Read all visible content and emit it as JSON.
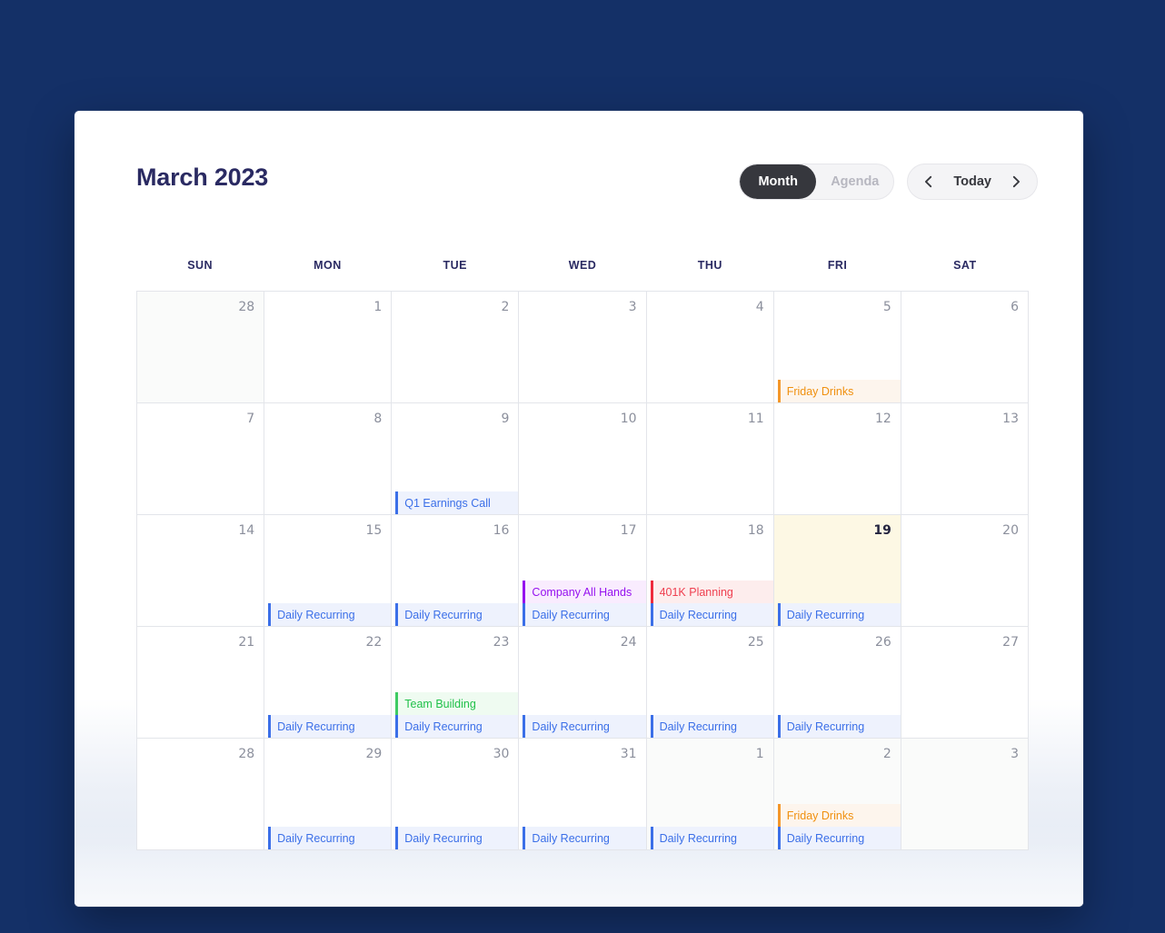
{
  "header": {
    "title": "March 2023",
    "views": [
      {
        "label": "Month",
        "active": true
      },
      {
        "label": "Agenda",
        "active": false
      }
    ],
    "nav": {
      "prev_icon": "chevron-left-icon",
      "today_label": "Today",
      "next_icon": "chevron-right-icon"
    }
  },
  "weekdays": [
    "SUN",
    "MON",
    "TUE",
    "WED",
    "THU",
    "FRI",
    "SAT"
  ],
  "colors": {
    "page_background": "#143067",
    "card_background": "#ffffff",
    "title": "#2a2a62",
    "grid_line": "#e3e5ea",
    "day_number": "#8b8f9c",
    "today_background": "#fdf8e4",
    "other_month_background": "#fafbfa",
    "segment_active_background": "#36373d",
    "event_blue": "#3b6fe8",
    "event_orange": "#f0900f",
    "event_purple": "#9611ef",
    "event_red": "#ef4050",
    "event_green": "#21c14a"
  },
  "weeks": [
    {
      "days": [
        {
          "number": "28",
          "other_month": true,
          "today": false,
          "events": []
        },
        {
          "number": "1",
          "other_month": false,
          "today": false,
          "events": []
        },
        {
          "number": "2",
          "other_month": false,
          "today": false,
          "events": []
        },
        {
          "number": "3",
          "other_month": false,
          "today": false,
          "events": []
        },
        {
          "number": "4",
          "other_month": false,
          "today": false,
          "events": []
        },
        {
          "number": "5",
          "other_month": false,
          "today": false,
          "events": [
            {
              "title": "Friday Drinks",
              "color": "orange"
            }
          ]
        },
        {
          "number": "6",
          "other_month": false,
          "today": false,
          "events": []
        }
      ]
    },
    {
      "days": [
        {
          "number": "7",
          "other_month": false,
          "today": false,
          "events": []
        },
        {
          "number": "8",
          "other_month": false,
          "today": false,
          "events": []
        },
        {
          "number": "9",
          "other_month": false,
          "today": false,
          "events": [
            {
              "title": "Q1 Earnings Call",
              "color": "blue"
            }
          ]
        },
        {
          "number": "10",
          "other_month": false,
          "today": false,
          "events": []
        },
        {
          "number": "11",
          "other_month": false,
          "today": false,
          "events": []
        },
        {
          "number": "12",
          "other_month": false,
          "today": false,
          "events": []
        },
        {
          "number": "13",
          "other_month": false,
          "today": false,
          "events": []
        }
      ]
    },
    {
      "days": [
        {
          "number": "14",
          "other_month": false,
          "today": false,
          "events": []
        },
        {
          "number": "15",
          "other_month": false,
          "today": false,
          "events": [
            {
              "title": "Daily Recurring",
              "color": "blue"
            }
          ]
        },
        {
          "number": "16",
          "other_month": false,
          "today": false,
          "events": [
            {
              "title": "Daily Recurring",
              "color": "blue"
            }
          ]
        },
        {
          "number": "17",
          "other_month": false,
          "today": false,
          "events": [
            {
              "title": "Company All Hands",
              "color": "purple"
            },
            {
              "title": "Daily Recurring",
              "color": "blue"
            }
          ]
        },
        {
          "number": "18",
          "other_month": false,
          "today": false,
          "events": [
            {
              "title": "401K Planning",
              "color": "red"
            },
            {
              "title": "Daily Recurring",
              "color": "blue"
            }
          ]
        },
        {
          "number": "19",
          "other_month": false,
          "today": true,
          "events": [
            {
              "title": "Daily Recurring",
              "color": "blue"
            }
          ]
        },
        {
          "number": "20",
          "other_month": false,
          "today": false,
          "events": []
        }
      ]
    },
    {
      "days": [
        {
          "number": "21",
          "other_month": false,
          "today": false,
          "events": []
        },
        {
          "number": "22",
          "other_month": false,
          "today": false,
          "events": [
            {
              "title": "Daily Recurring",
              "color": "blue"
            }
          ]
        },
        {
          "number": "23",
          "other_month": false,
          "today": false,
          "events": [
            {
              "title": "Team Building",
              "color": "green"
            },
            {
              "title": "Daily Recurring",
              "color": "blue"
            }
          ]
        },
        {
          "number": "24",
          "other_month": false,
          "today": false,
          "events": [
            {
              "title": "Daily Recurring",
              "color": "blue"
            }
          ]
        },
        {
          "number": "25",
          "other_month": false,
          "today": false,
          "events": [
            {
              "title": "Daily Recurring",
              "color": "blue"
            }
          ]
        },
        {
          "number": "26",
          "other_month": false,
          "today": false,
          "events": [
            {
              "title": "Daily Recurring",
              "color": "blue"
            }
          ]
        },
        {
          "number": "27",
          "other_month": false,
          "today": false,
          "events": []
        }
      ]
    },
    {
      "days": [
        {
          "number": "28",
          "other_month": false,
          "today": false,
          "events": []
        },
        {
          "number": "29",
          "other_month": false,
          "today": false,
          "events": [
            {
              "title": "Daily Recurring",
              "color": "blue"
            }
          ]
        },
        {
          "number": "30",
          "other_month": false,
          "today": false,
          "events": [
            {
              "title": "Daily Recurring",
              "color": "blue"
            }
          ]
        },
        {
          "number": "31",
          "other_month": false,
          "today": false,
          "events": [
            {
              "title": "Daily Recurring",
              "color": "blue"
            }
          ]
        },
        {
          "number": "1",
          "other_month": true,
          "today": false,
          "events": [
            {
              "title": "Daily Recurring",
              "color": "blue"
            }
          ]
        },
        {
          "number": "2",
          "other_month": true,
          "today": false,
          "events": [
            {
              "title": "Friday Drinks",
              "color": "orange"
            },
            {
              "title": "Daily Recurring",
              "color": "blue"
            }
          ]
        },
        {
          "number": "3",
          "other_month": true,
          "today": false,
          "events": []
        }
      ]
    }
  ]
}
